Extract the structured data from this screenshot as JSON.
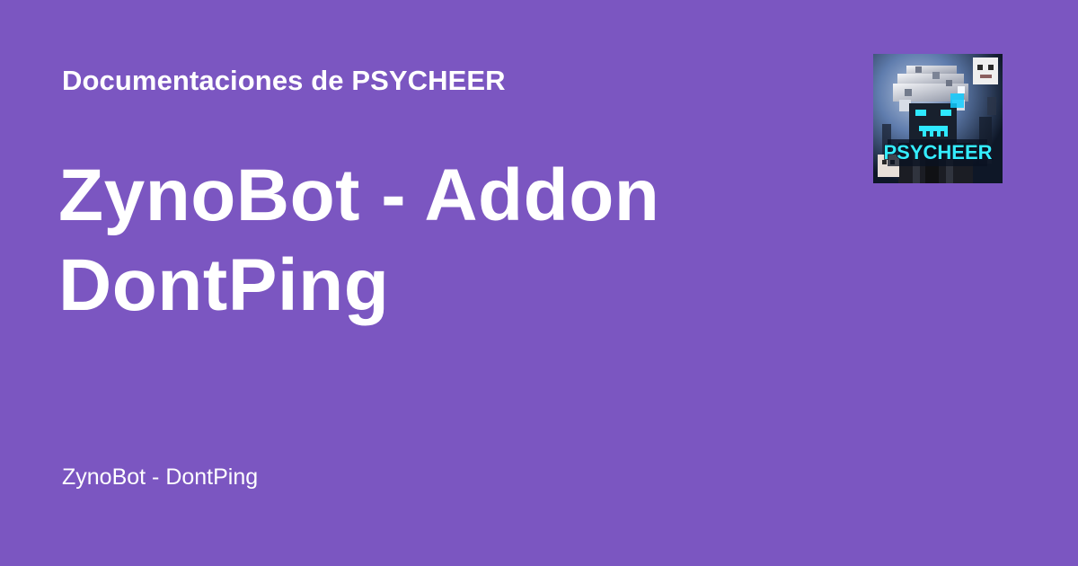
{
  "header": {
    "site_name": "Documentaciones de PSYCHEER"
  },
  "main": {
    "title_line_1": "ZynoBot - Addon",
    "title_line_2": "DontPing"
  },
  "footer": {
    "subtitle": "ZynoBot - DontPing"
  },
  "logo": {
    "text": "PSYCHEER",
    "icon": "psycheer-avatar-icon"
  },
  "colors": {
    "background": "#7b56c1",
    "text": "#ffffff",
    "logo_accent": "#2ee8ff"
  }
}
